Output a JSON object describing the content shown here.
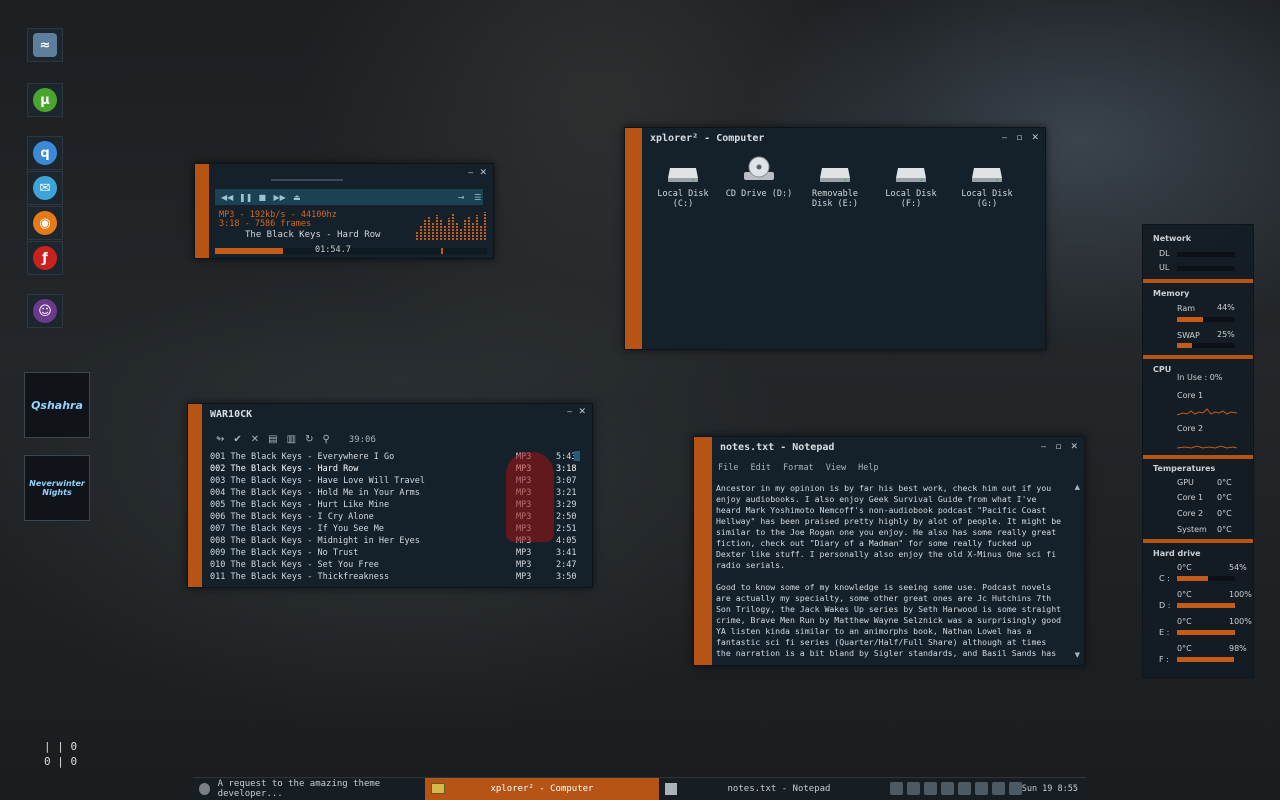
{
  "colors": {
    "accent": "#b65416",
    "window_bg": "#15212a",
    "highlight": "#c55b18"
  },
  "dock": {
    "icons": [
      "shark-icon",
      "utorrent-icon",
      "qbittorrent-icon",
      "messenger-icon",
      "firefox-icon",
      "flash-icon",
      "game-alien-icon"
    ],
    "games": [
      "Qshahra",
      "Neverwinter Nights"
    ]
  },
  "counter": {
    "top": "0",
    "bottom": "0"
  },
  "winamp": {
    "info_line1": "MP3 - 192kb/s - 44100hz",
    "info_line2": "3:18 - 7586 frames",
    "track": "The Black Keys - Hard Row",
    "elapsed": "01:54.7",
    "progress_percent": 25,
    "viz_levels": [
      0.3,
      0.55,
      0.7,
      0.85,
      0.6,
      0.9,
      0.75,
      0.5,
      0.8,
      0.95,
      0.65,
      0.4,
      0.7,
      0.85,
      0.6,
      0.9,
      0.55,
      1.0
    ]
  },
  "playlist": {
    "title": "WAR10CK",
    "total_time": "39:06",
    "rows": [
      {
        "num": "001",
        "title": "The Black Keys - Everywhere I Go",
        "fmt": "MP3",
        "dur": "5:43"
      },
      {
        "num": "002",
        "title": "The Black Keys - Hard Row",
        "fmt": "MP3",
        "dur": "3:18"
      },
      {
        "num": "003",
        "title": "The Black Keys - Have Love Will Travel",
        "fmt": "MP3",
        "dur": "3:07"
      },
      {
        "num": "004",
        "title": "The Black Keys - Hold Me in Your Arms",
        "fmt": "MP3",
        "dur": "3:21"
      },
      {
        "num": "005",
        "title": "The Black Keys - Hurt Like Mine",
        "fmt": "MP3",
        "dur": "3:29"
      },
      {
        "num": "006",
        "title": "The Black Keys - I Cry Alone",
        "fmt": "MP3",
        "dur": "2:50"
      },
      {
        "num": "007",
        "title": "The Black Keys - If You See Me",
        "fmt": "MP3",
        "dur": "2:51"
      },
      {
        "num": "008",
        "title": "The Black Keys - Midnight in Her Eyes",
        "fmt": "MP3",
        "dur": "4:05"
      },
      {
        "num": "009",
        "title": "The Black Keys - No Trust",
        "fmt": "MP3",
        "dur": "3:41"
      },
      {
        "num": "010",
        "title": "The Black Keys - Set You Free",
        "fmt": "MP3",
        "dur": "2:47"
      },
      {
        "num": "011",
        "title": "The Black Keys - Thickfreakness",
        "fmt": "MP3",
        "dur": "3:50"
      }
    ]
  },
  "explorer": {
    "title": "xplorer² - Computer",
    "drives": [
      {
        "label": "Local Disk (C:)",
        "type": "hdd"
      },
      {
        "label": "CD Drive (D:)",
        "type": "cd"
      },
      {
        "label": "Removable Disk (E:)",
        "type": "hdd"
      },
      {
        "label": "Local Disk (F:)",
        "type": "hdd"
      },
      {
        "label": "Local Disk (G:)",
        "type": "hdd"
      }
    ]
  },
  "notepad": {
    "title": "notes.txt - Notepad",
    "menu": [
      "File",
      "Edit",
      "Format",
      "View",
      "Help"
    ],
    "text": "Ancestor in my opinion is by far his best work, check him out if you enjoy audiobooks. I also enjoy Geek Survival Guide from what I've heard Mark Yoshimoto Nemcoff's non-audiobook podcast \"Pacific Coast Hellway\" has been praised pretty highly by alot of people. It might be similar to the Joe Rogan one you enjoy. He also has some really great fiction, check out \"Diary of a Madman\" for some really fucked up Dexter like stuff. I personally also enjoy the old X-Minus One sci fi radio serials.\n\nGood to know some of my knowledge is seeing some use. Podcast novels are actually my specialty, some other great ones are Jc Hutchins 7th Son Trilogy, the Jack Wakes Up series by Seth Harwood is some straight crime, Brave Men Run by Matthew Wayne Selznick was a surprisingly good YA listen kinda similar to an animorphs book, Nathan Lowel has a fantastic sci fi series (Quarter/Half/Full Share) although at times the narration is a bit bland by Sigler standards, and Basil Sands has some awesome military thrillers."
  },
  "gadget": {
    "network": {
      "heading": "Network",
      "dl": "DL",
      "ul": "UL"
    },
    "memory": {
      "heading": "Memory",
      "ram_label": "Ram",
      "ram_value": "44%",
      "ram_pct": 44,
      "swap_label": "SWAP",
      "swap_value": "25%",
      "swap_pct": 25
    },
    "cpu": {
      "heading": "CPU",
      "in_use": "In Use : 0%",
      "core1": "Core 1",
      "core2": "Core 2"
    },
    "temps": {
      "heading": "Temperatures",
      "rows": [
        {
          "label": "GPU",
          "value": "0°C"
        },
        {
          "label": "Core 1",
          "value": "0°C"
        },
        {
          "label": "Core 2",
          "value": "0°C"
        },
        {
          "label": "System",
          "value": "0°C"
        }
      ]
    },
    "drives": {
      "heading": "Hard drive",
      "rows": [
        {
          "letter": "C :",
          "temp": "0°C",
          "pct_text": "54%",
          "pct": 54
        },
        {
          "letter": "D :",
          "temp": "0°C",
          "pct_text": "100%",
          "pct": 100
        },
        {
          "letter": "E :",
          "temp": "0°C",
          "pct_text": "100%",
          "pct": 100
        },
        {
          "letter": "F :",
          "temp": "0°C",
          "pct_text": "98%",
          "pct": 98
        }
      ]
    }
  },
  "taskbar": {
    "tasks": [
      {
        "label": "A request to the amazing theme developer...",
        "active": false
      },
      {
        "label": "xplorer² - Computer",
        "active": true
      },
      {
        "label": "notes.txt - Notepad",
        "active": false
      }
    ],
    "clock": "Sun 19  8:55"
  }
}
